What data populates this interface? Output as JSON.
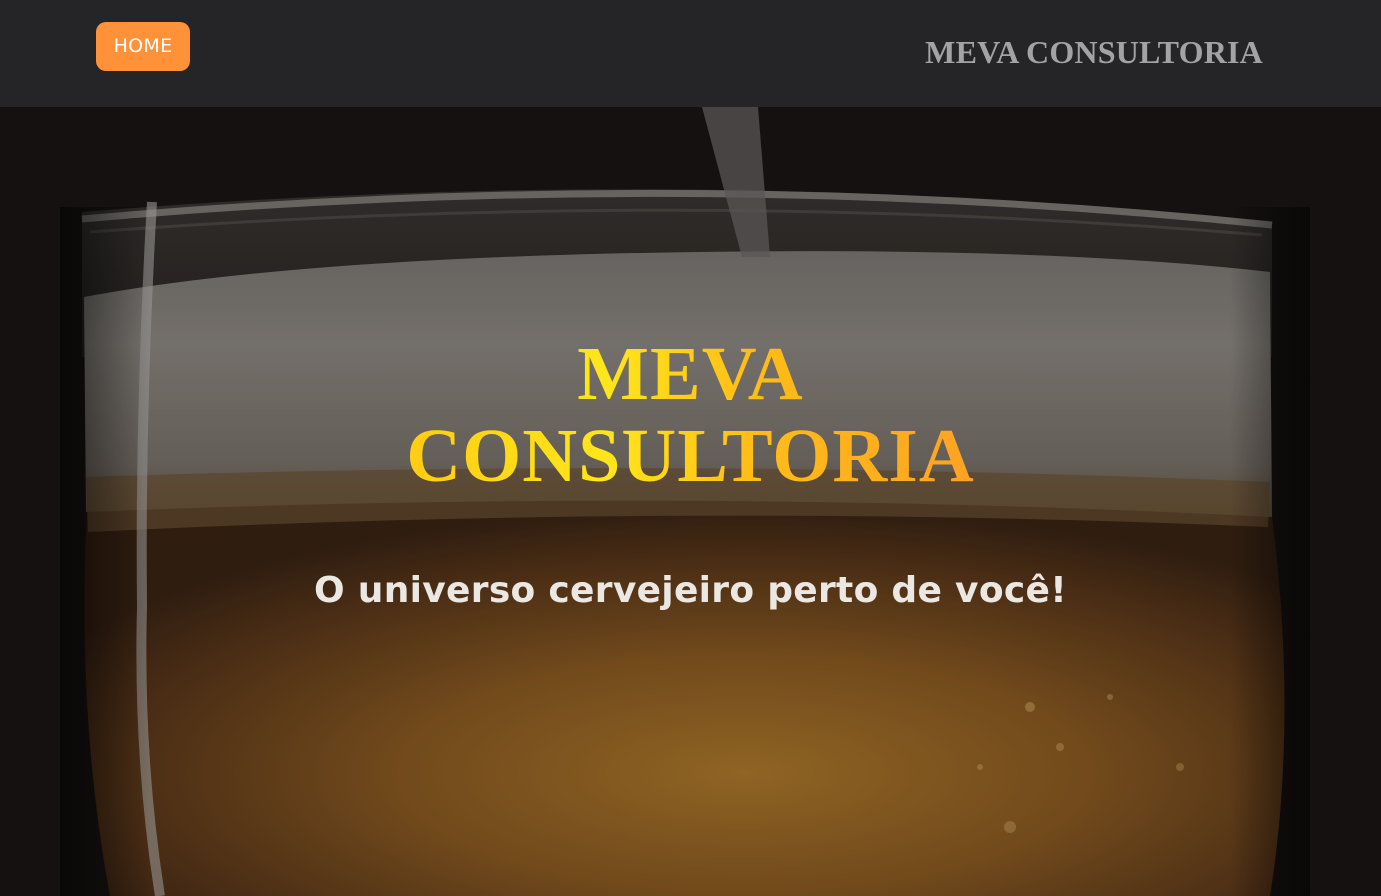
{
  "nav": {
    "home_label": "HOME",
    "brand": "MEVA CONSULTORIA"
  },
  "hero": {
    "title_line1": "MEVA",
    "title_line2": "CONSULTORIA",
    "subtitle": "O universo cervejeiro perto de você!"
  },
  "colors": {
    "topbar": "#252527",
    "home_button": "#ff9138",
    "brand_text": "#a3a3a6",
    "title_gold": "#ffc21a",
    "subtitle_text": "#ebe7e2"
  }
}
